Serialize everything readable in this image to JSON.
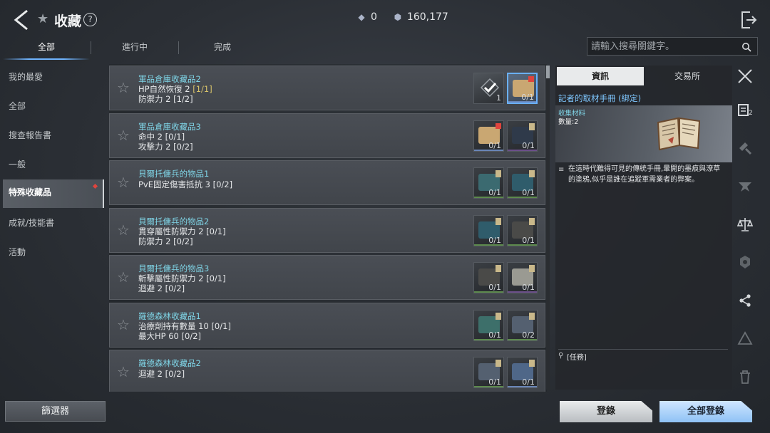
{
  "header": {
    "title": "收藏",
    "help": "?",
    "currency_a": "0",
    "currency_b": "160,177"
  },
  "tabs": [
    "全部",
    "進行中",
    "完成"
  ],
  "search": {
    "placeholder": "請輸入搜尋關鍵字。"
  },
  "sidebar": {
    "items": [
      "我的最愛",
      "全部",
      "搜查報告書",
      "一般",
      "特殊收藏品",
      "成就/技能書",
      "活動"
    ],
    "active_index": 4
  },
  "filter_label": "篩選器",
  "list": [
    {
      "title": "軍品倉庫收藏品2",
      "lines": [
        {
          "text": "HP自然恢復 2 ",
          "prog": "[1/1]"
        },
        {
          "text": "防禦力 2 [1/2]",
          "prog": ""
        }
      ],
      "items": [
        {
          "count": "1",
          "kind": "checked"
        },
        {
          "count": "0/1",
          "kind": "book-selected"
        }
      ]
    },
    {
      "title": "軍品倉庫收藏品3",
      "lines": [
        {
          "text": "命中 2 [0/1]",
          "prog": ""
        },
        {
          "text": "攻擊力 2 [0/2]",
          "prog": ""
        }
      ],
      "items": [
        {
          "count": "0/1",
          "kind": "book"
        },
        {
          "count": "0/1",
          "kind": "dark"
        }
      ]
    },
    {
      "title": "貝爾托傭兵的物品1",
      "lines": [
        {
          "text": "PvE固定傷害抵抗 3 [0/2]",
          "prog": ""
        }
      ],
      "items": [
        {
          "count": "0/1",
          "kind": "device"
        },
        {
          "count": "0/1",
          "kind": "screen"
        }
      ]
    },
    {
      "title": "貝爾托傭兵的物品2",
      "lines": [
        {
          "text": "貫穿屬性防禦力 2 [0/1]",
          "prog": ""
        },
        {
          "text": "防禦力 2 [0/2]",
          "prog": ""
        }
      ],
      "items": [
        {
          "count": "0/1",
          "kind": "screen"
        },
        {
          "count": "0/1",
          "kind": "gadget"
        }
      ]
    },
    {
      "title": "貝爾托傭兵的物品3",
      "lines": [
        {
          "text": "斬擊屬性防禦力 2 [0/1]",
          "prog": ""
        },
        {
          "text": "迴避 2 [0/2]",
          "prog": ""
        }
      ],
      "items": [
        {
          "count": "0/1",
          "kind": "gadget"
        },
        {
          "count": "0/1",
          "kind": "stone"
        }
      ]
    },
    {
      "title": "羅德森林收藏品1",
      "lines": [
        {
          "text": "治療劑持有數量 10 [0/1]",
          "prog": ""
        },
        {
          "text": "最大HP 60 [0/2]",
          "prog": ""
        }
      ],
      "items": [
        {
          "count": "0/1",
          "kind": "gun"
        },
        {
          "count": "0/2",
          "kind": "card"
        }
      ]
    },
    {
      "title": "羅德森林收藏品2",
      "lines": [
        {
          "text": "迴避 2 [0/2]",
          "prog": ""
        }
      ],
      "items": [
        {
          "count": "0/1",
          "kind": "card"
        },
        {
          "count": "0/1",
          "kind": "phone"
        }
      ]
    }
  ],
  "detail": {
    "tabs": [
      "資訊",
      "交易所"
    ],
    "name": "記者的取材手冊 (綁定)",
    "type": "收集材料",
    "quantity": "數量:2",
    "description": "在這時代難得可見的傳統手冊,暈開的墨痕與潦草的塗鴉,似乎是誰在追蹤軍需業者的弊案。",
    "mission": "[任務]"
  },
  "right_icons": [
    "close-icon",
    "inventory-icon",
    "craft-icon",
    "map-marker-icon",
    "scale-icon",
    "gear-icon",
    "share-icon",
    "alert-icon",
    "trash-icon"
  ],
  "inventory_badge": "2",
  "buttons": {
    "register": "登錄",
    "register_all": "全部登錄"
  },
  "colors": {
    "accent": "#6fb4ff",
    "title_cyan": "#7fd4e6",
    "progress_gold": "#d9c46a",
    "badge_red": "#e0443d"
  }
}
